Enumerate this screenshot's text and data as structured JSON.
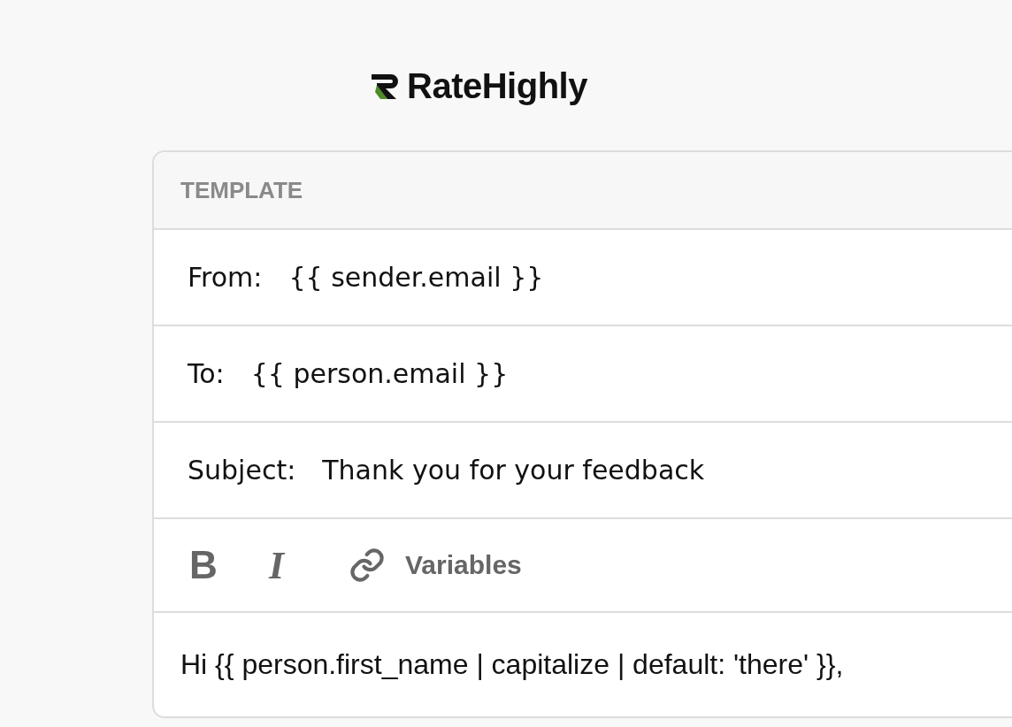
{
  "logo": {
    "text": "RateHighly"
  },
  "card": {
    "title": "TEMPLATE",
    "fields": [
      {
        "label": "From:",
        "value": "{{ sender.email }}"
      },
      {
        "label": "To:",
        "value": "{{ person.email }}"
      },
      {
        "label": "Subject:",
        "value": "Thank you for your feedback"
      }
    ],
    "toolbar": {
      "bold": "B",
      "italic": "I",
      "variables": "Variables"
    },
    "body": "Hi {{ person.first_name | capitalize | default: 'there' }},"
  }
}
